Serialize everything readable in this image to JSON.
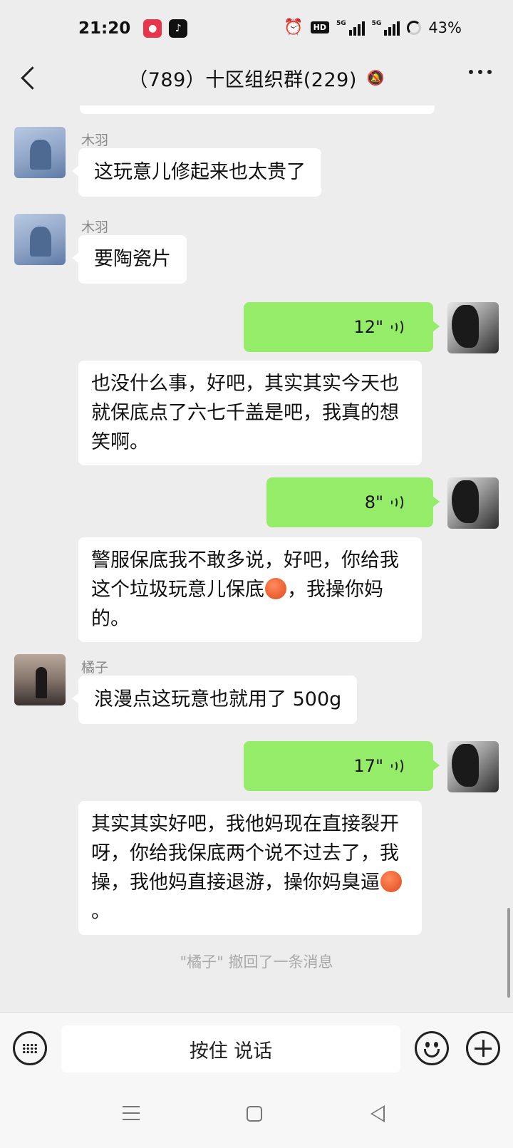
{
  "status_bar": {
    "time": "21:20",
    "network_5g_1": "5G",
    "network_5g_2": "5G",
    "hd_label": "HD",
    "battery": "43%"
  },
  "header": {
    "title": "（789）十区组织群(229)",
    "mute_icon": "bell-off-icon",
    "more_icon": "more-icon"
  },
  "messages": [
    {
      "type": "text",
      "side": "left",
      "sender": "木羽",
      "text": "这玩意儿修起来也太贵了"
    },
    {
      "type": "text",
      "side": "left",
      "sender": "木羽",
      "text": "要陶瓷片"
    },
    {
      "type": "voice",
      "side": "right",
      "duration": "12\"",
      "transcript": "也没什么事，好吧，其实其实今天也就保底点了六七千盖是吧，我真的想笑啊。"
    },
    {
      "type": "voice",
      "side": "right",
      "duration": "8\"",
      "transcript_a": "警服保底我不敢多说，好吧，你给我这个垃圾玩意儿保底",
      "transcript_b": "，我操你妈的。"
    },
    {
      "type": "text",
      "side": "left",
      "sender": "橘子",
      "text": "浪漫点这玩意也就用了 500g"
    },
    {
      "type": "voice",
      "side": "right",
      "duration": "17\"",
      "transcript_a": "其实其实好吧，我他妈现在直接裂开呀，你给我保底两个说不过去了，我操，我他妈直接退游，操你妈臭逼",
      "transcript_b": "。"
    }
  ],
  "system_message": "\"橘子\" 撤回了一条消息",
  "input_bar": {
    "hold_to_talk": "按住 说话",
    "keyboard_icon": "keyboard-icon",
    "emoji_icon": "emoji-icon",
    "plus_icon": "plus-icon"
  },
  "colors": {
    "chat_bg": "#ededed",
    "voice_bubble": "#95ec69",
    "text_bubble": "#ffffff"
  }
}
